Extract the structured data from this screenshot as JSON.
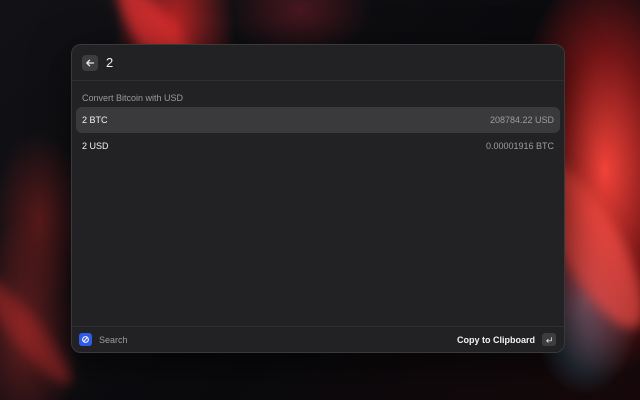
{
  "header": {
    "query": "2"
  },
  "section": {
    "title": "Convert Bitcoin with USD"
  },
  "results": [
    {
      "title": "2 BTC",
      "value": "208784.22 USD",
      "selected": true
    },
    {
      "title": "2 USD",
      "value": "0.00001916 BTC",
      "selected": false
    }
  ],
  "footer": {
    "search_label": "Search",
    "action_label": "Copy to Clipboard",
    "enter_icon": "enter-key-icon",
    "app_icon": "app-logo-icon"
  },
  "colors": {
    "accent": "#2f5bea",
    "window_bg": "#222224",
    "selected_row": "#3a3a3d"
  }
}
